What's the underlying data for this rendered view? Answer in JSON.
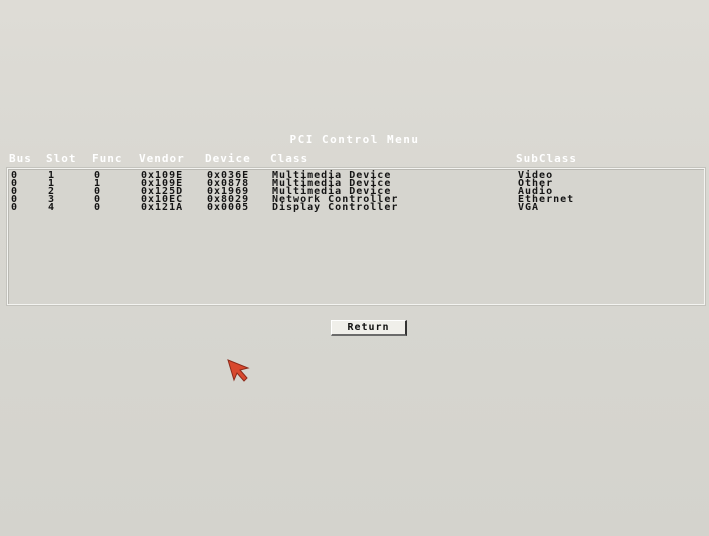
{
  "menu": {
    "title": "PCI Control Menu"
  },
  "table": {
    "headers": [
      "Bus",
      "Slot",
      "Func",
      "Vendor",
      "Device",
      "Class",
      "SubClass"
    ],
    "rows": [
      [
        "0",
        "1",
        "0",
        "0x109E",
        "0x036E",
        "Multimedia Device",
        "Video"
      ],
      [
        "0",
        "1",
        "1",
        "0x109E",
        "0x0878",
        "Multimedia Device",
        "Other"
      ],
      [
        "0",
        "2",
        "0",
        "0x125D",
        "0x1969",
        "Multimedia Device",
        "Audio"
      ],
      [
        "0",
        "3",
        "0",
        "0x10EC",
        "0x8029",
        "Network Controller",
        "Ethernet"
      ],
      [
        "0",
        "4",
        "0",
        "0x121A",
        "0x0005",
        "Display Controller",
        "VGA"
      ]
    ]
  },
  "buttons": {
    "return_label": "Return"
  },
  "colors": {
    "background": "#d9d8d3",
    "heading_text": "#ffffff",
    "row_text": "#151515",
    "cursor": "#d8482e"
  },
  "icons": {
    "cursor": "mouse-pointer-arrow-icon"
  }
}
